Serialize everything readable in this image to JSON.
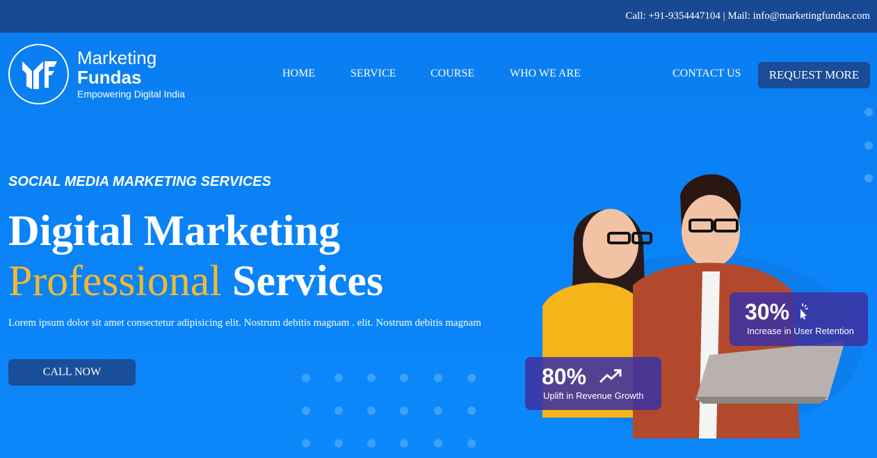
{
  "topbar": {
    "contact": "Call: +91-9354447104 | Mail: info@marketingfundas.com"
  },
  "logo": {
    "line1": "Marketing",
    "line2": "Fundas",
    "tagline": "Empowering Digital India"
  },
  "nav": {
    "items": [
      "HOME",
      "SERVICE",
      "COURSE",
      "WHO WE ARE",
      "CONTACT US"
    ],
    "cta": "REQUEST MORE"
  },
  "hero": {
    "eyebrow": "SOCIAL MEDIA MARKETING SERVICES",
    "headline_line1": "Digital Marketing",
    "headline_accent": "Professional",
    "headline_rest": "Services",
    "lede": "Lorem ipsum dolor sit amet consectetur adipisicing elit. Nostrum debitis magnam . elit. Nostrum debitis magnam",
    "cta": "CALL NOW"
  },
  "stats": [
    {
      "value": "30%",
      "label": "Increase in User Retention",
      "icon": "pointer-click-icon"
    },
    {
      "value": "80%",
      "label": "Uplift in Revenue Growth",
      "icon": "trend-up-icon"
    }
  ],
  "colors": {
    "topbar": "#184a94",
    "accent": "#f5b82e",
    "button": "#1a4c97"
  }
}
